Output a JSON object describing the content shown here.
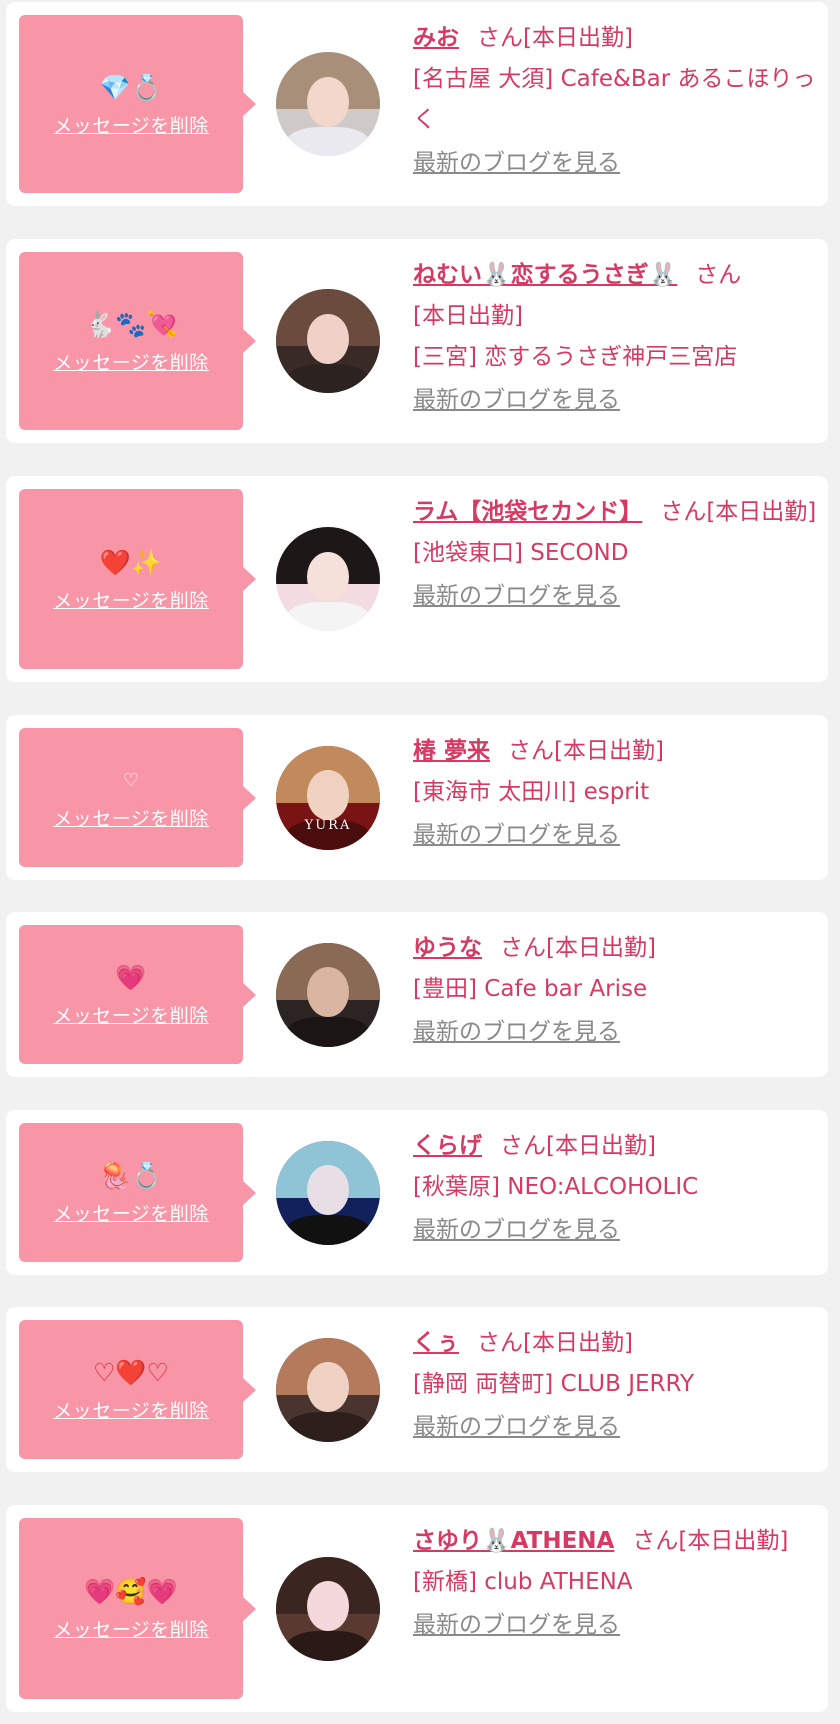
{
  "items": [
    {
      "emoji": "💎💍",
      "delete_label": "メッセージを削除",
      "name": "みお",
      "honorific": "さん",
      "status": "[本日出勤]",
      "shop": "[名古屋 大須] Cafe&Bar あるこほりっく",
      "blog_label": "最新のブログを見る",
      "avatar_colors": {
        "bg": "#cfc9c7",
        "hair": "#a88f7a",
        "face": "#f2d7ca",
        "body": "#e9e9ef"
      }
    },
    {
      "emoji": "🐇🐾💘",
      "delete_label": "メッセージを削除",
      "name": "ねむい🐰恋するうさぎ🐰",
      "honorific": "さん",
      "status": "[本日出勤]",
      "shop": "[三宮] 恋するうさぎ神戸三宮店",
      "blog_label": "最新のブログを見る",
      "avatar_colors": {
        "bg": "#3a2a26",
        "hair": "#6b4b3e",
        "face": "#efd1c8",
        "body": "#2c2320"
      }
    },
    {
      "emoji": "❤️✨",
      "delete_label": "メッセージを削除",
      "name": "ラム【池袋セカンド】",
      "honorific": "さん",
      "status": "[本日出勤]",
      "shop": "[池袋東口] SECOND",
      "blog_label": "最新のブログを見る",
      "avatar_colors": {
        "bg": "#f3dbe2",
        "hair": "#1e1718",
        "face": "#f6e0da",
        "body": "#f4f4f4"
      }
    },
    {
      "emoji": "♡",
      "delete_label": "メッセージを削除",
      "name": "椿 夢来",
      "honorific": "さん",
      "status": "[本日出勤]",
      "shop": "[東海市 太田川] esprit",
      "blog_label": "最新のブログを見る",
      "avatar_text": "YURA",
      "avatar_colors": {
        "bg": "#7a1313",
        "hair": "#c18a5c",
        "face": "#f1d1c0",
        "body": "#4a0c0c"
      }
    },
    {
      "emoji": "💗",
      "delete_label": "メッセージを削除",
      "name": "ゆうな",
      "honorific": "さん",
      "status": "[本日出勤]",
      "shop": "[豊田] Cafe bar Arise",
      "blog_label": "最新のブログを見る",
      "avatar_colors": {
        "bg": "#2b2422",
        "hair": "#8a6a55",
        "face": "#d9b5a2",
        "body": "#1b1615"
      }
    },
    {
      "emoji": "🪼💍",
      "delete_label": "メッセージを削除",
      "name": "くらげ",
      "honorific": "さん",
      "status": "[本日出勤]",
      "shop": "[秋葉原] NEO:ALCOHOLIC",
      "blog_label": "最新のブログを見る",
      "avatar_colors": {
        "bg": "#12205c",
        "hair": "#8fc4d6",
        "face": "#e8dfe6",
        "body": "#111111"
      }
    },
    {
      "emoji": "♡❤️♡",
      "delete_label": "メッセージを削除",
      "name": "くぅ",
      "honorific": "さん",
      "status": "[本日出勤]",
      "shop": "[静岡 両替町] CLUB JERRY",
      "blog_label": "最新のブログを見る",
      "avatar_colors": {
        "bg": "#4a3430",
        "hair": "#b37a5c",
        "face": "#f0d2c4",
        "body": "#2d1f1c"
      }
    },
    {
      "emoji": "💗🥰💗",
      "delete_label": "メッセージを削除",
      "name": "さゆり🐰ATHENA",
      "honorific": "さん",
      "status": "[本日出勤]",
      "shop": "[新橋] club ATHENA",
      "blog_label": "最新のブログを見る",
      "avatar_colors": {
        "bg": "#5a3a30",
        "hair": "#3a2520",
        "face": "#f4d8dc",
        "body": "#2a1a17"
      }
    }
  ]
}
